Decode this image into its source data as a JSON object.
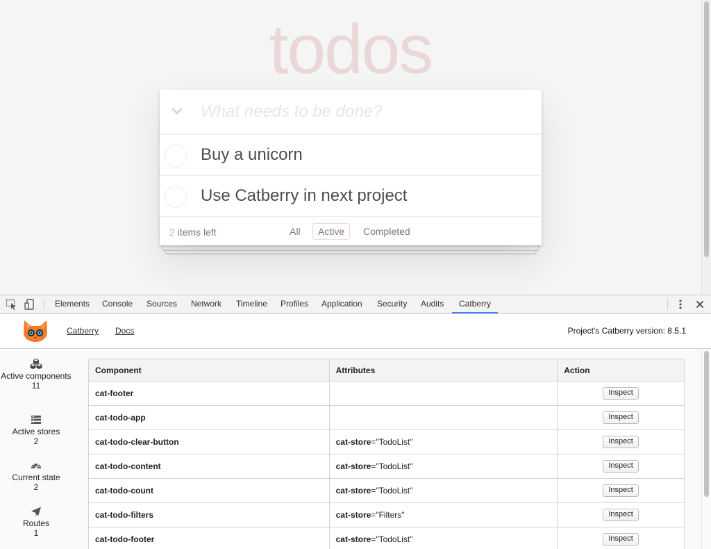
{
  "todo_app": {
    "title": "todos",
    "new_todo_placeholder": "What needs to be done?",
    "items": [
      {
        "label": "Buy a unicorn",
        "completed": false
      },
      {
        "label": "Use Catberry in next project",
        "completed": false
      }
    ],
    "footer": {
      "count": "2",
      "count_suffix": " items left",
      "filters": [
        "All",
        "Active",
        "Completed"
      ],
      "selected_filter": "Active"
    }
  },
  "devtools": {
    "tabs": [
      "Elements",
      "Console",
      "Sources",
      "Network",
      "Timeline",
      "Profiles",
      "Application",
      "Security",
      "Audits",
      "Catberry"
    ],
    "selected_tab": "Catberry",
    "accent_color": "#3e82f7"
  },
  "catberry": {
    "header": {
      "links": [
        "Catberry",
        "Docs"
      ],
      "version_text": "Project's Catberry version: 8.5.1"
    },
    "sidebar": [
      {
        "icon": "cubes-icon",
        "label": "Active components",
        "count": "11"
      },
      {
        "icon": "stores-icon",
        "label": "Active stores",
        "count": "2"
      },
      {
        "icon": "dashboard-icon",
        "label": "Current state",
        "count": "2"
      },
      {
        "icon": "paper-plane-icon",
        "label": "Routes",
        "count": "1"
      }
    ],
    "table": {
      "headers": [
        "Component",
        "Attributes",
        "Action"
      ],
      "rows": [
        {
          "component": "cat-footer",
          "attr_name": "",
          "attr_eq": "",
          "attr_value": "",
          "action": "Inspect"
        },
        {
          "component": "cat-todo-app",
          "attr_name": "",
          "attr_eq": "",
          "attr_value": "",
          "action": "Inspect"
        },
        {
          "component": "cat-todo-clear-button",
          "attr_name": "cat-store",
          "attr_eq": "=",
          "attr_value": "\"TodoList\"",
          "action": "Inspect"
        },
        {
          "component": "cat-todo-content",
          "attr_name": "cat-store",
          "attr_eq": "=",
          "attr_value": "\"TodoList\"",
          "action": "Inspect"
        },
        {
          "component": "cat-todo-count",
          "attr_name": "cat-store",
          "attr_eq": "=",
          "attr_value": "\"TodoList\"",
          "action": "Inspect"
        },
        {
          "component": "cat-todo-filters",
          "attr_name": "cat-store",
          "attr_eq": "=",
          "attr_value": "\"Filters\"",
          "action": "Inspect"
        },
        {
          "component": "cat-todo-footer",
          "attr_name": "cat-store",
          "attr_eq": "=",
          "attr_value": "\"TodoList\"",
          "action": "Inspect"
        }
      ]
    }
  }
}
